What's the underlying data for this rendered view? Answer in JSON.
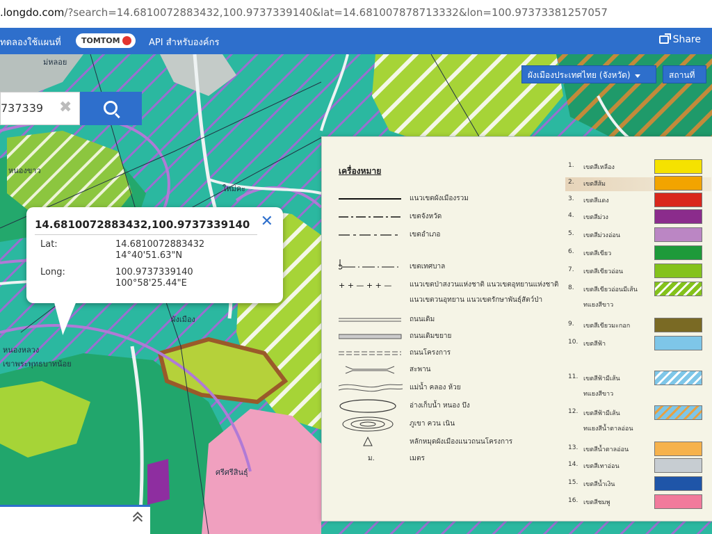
{
  "browser": {
    "url_host": ".longdo.com",
    "url_rest": "/?search=14.6810072883432,100.9737339140&lat=14.681007878713332&lon=100.97373381257057"
  },
  "nav": {
    "promo": "ทดลองใช้แผนที่",
    "tomtom": "TOMTOM",
    "api": "API สำหรับองค์กร",
    "share": "Share",
    "share_icon": "share-icon"
  },
  "layers": {
    "main_label": "ผังเมืองประเทศไทย (จังหวัด)",
    "alt_label": "สถานที่"
  },
  "search": {
    "value": "737339",
    "clear_icon": "close-icon",
    "button_icon": "search-icon"
  },
  "popup": {
    "title": "14.6810072883432,100.9737339140",
    "lat_label": "Lat:",
    "lat_decimal": "14.6810072883432",
    "lat_dms": "14°40'51.63\"N",
    "lon_label": "Long:",
    "lon_decimal": "100.9737339140",
    "lon_dms": "100°58'25.44\"E"
  },
  "legend": {
    "heading": "เครื่องหมาย",
    "line_items": [
      {
        "label": "แนวเขตผังเมืองรวม"
      },
      {
        "label": "เขตจังหวัด"
      },
      {
        "label": "เขตอำเภอ"
      },
      {
        "label": "เขตเทศบาล"
      },
      {
        "label": "แนวเขตป่าสงวนแห่งชาติ แนวเขตอุทยานแห่งชาติ"
      },
      {
        "label": "แนวเขตวนอุทยาน แนวเขตรักษาพันธุ์สัตว์ป่า"
      },
      {
        "label": "ถนนเดิม"
      },
      {
        "label": "ถนนเดิมขยาย"
      },
      {
        "label": "ถนนโครงการ"
      },
      {
        "label": "สะพาน"
      },
      {
        "label": "แม่น้ำ คลอง ห้วย"
      },
      {
        "label": "อ่างเก็บน้ำ หนอง บึง"
      },
      {
        "label": "ภูเขา ควน เนิน"
      },
      {
        "label": "หลักหมุดผังเมืองแนวถนนโครงการ"
      },
      {
        "label": "เมตร",
        "mark": "ม."
      }
    ],
    "zones": [
      {
        "num": "1.",
        "label": "เขตสีเหลือง",
        "color": "#f5e200"
      },
      {
        "num": "2.",
        "label": "เขตสีส้ม",
        "color": "#f2a400"
      },
      {
        "num": "3.",
        "label": "เขตสีแดง",
        "color": "#d9271c"
      },
      {
        "num": "4.",
        "label": "เขตสีม่วง",
        "color": "#8b2c8c"
      },
      {
        "num": "5.",
        "label": "เขตสีม่วงอ่อน",
        "color": "#bb86c4"
      },
      {
        "num": "6.",
        "label": "เขตสีเขียว",
        "color": "#1e9a3a"
      },
      {
        "num": "7.",
        "label": "เขตสีเขียวอ่อน",
        "color": "#84c21b"
      },
      {
        "num": "8.",
        "label": "เขตสีเขียวอ่อนมีเส้น",
        "sub": "ทแยงสีขาว",
        "color": "#84c21b",
        "hatch": "white"
      },
      {
        "num": "9.",
        "label": "เขตสีเขียวมะกอก",
        "color": "#7a6a24"
      },
      {
        "num": "10.",
        "label": "เขตสีฟ้า",
        "color": "#7ec6e8"
      },
      {
        "num": "11.",
        "label": "เขตสีฟ้ามีเส้น",
        "sub": "ทแยงสีขาว",
        "color": "#7ec6e8",
        "hatch": "white"
      },
      {
        "num": "12.",
        "label": "เขตสีฟ้ามีเส้น",
        "sub": "ทแยงสีน้ำตาลอ่อน",
        "color": "#7ec6e8",
        "hatch": "orange"
      },
      {
        "num": "13.",
        "label": "เขตสีน้ำตาลอ่อน",
        "color": "#f6b24c"
      },
      {
        "num": "14.",
        "label": "เขตสีเทาอ่อน",
        "color": "#c7cdd2"
      },
      {
        "num": "15.",
        "label": "เขตสีน้ำเงิน",
        "color": "#1f55a8"
      },
      {
        "num": "16.",
        "label": "เขตสีชมพู",
        "color": "#f17a9c"
      }
    ]
  },
  "map_labels": [
    {
      "text": "ม่หลอย"
    },
    {
      "text": "หนองขาว"
    },
    {
      "text": "เขาพระพุทธบาทน้อย"
    },
    {
      "text": "หนองหลวง"
    },
    {
      "text": "ผังเมือง"
    },
    {
      "text": "ศรีศรีสินธุ์"
    },
    {
      "text": "ใหม่คะ"
    }
  ],
  "bottom_panel": {
    "expand_icon": "chevron-up-icon"
  },
  "colors": {
    "accent": "#2e6fcc",
    "map_teal": "#2bb8a0",
    "map_green": "#22a86a",
    "map_lightgreen": "#a6d437",
    "map_pink": "#f0a0bf",
    "map_purple": "#8e2ea0"
  }
}
